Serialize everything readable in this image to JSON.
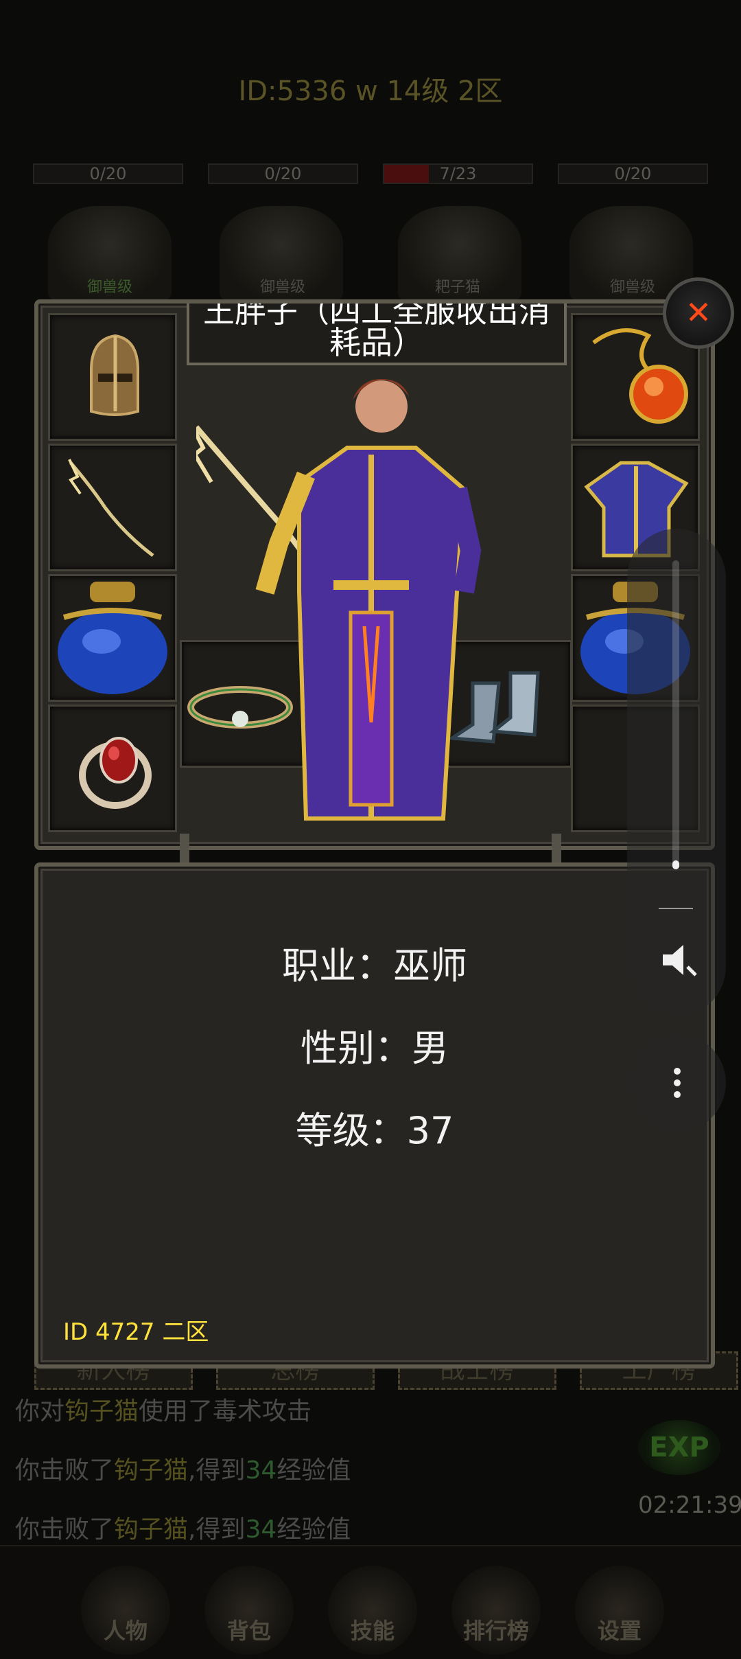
{
  "top_status": "ID:5336  w  14级  2区",
  "hp_bars": [
    {
      "text": "0/20",
      "fill": 0
    },
    {
      "text": "0/20",
      "fill": 0
    },
    {
      "text": "7/23",
      "fill": 0.3
    },
    {
      "text": "0/20",
      "fill": 0
    }
  ],
  "monsters": [
    "御兽级",
    "御兽级",
    "耙子猫",
    "御兽级"
  ],
  "dialog": {
    "title": "王胖子（四工全服收出消耗品）",
    "info": {
      "profession": "职业：巫师",
      "gender": "性别：男",
      "level": "等级：37"
    },
    "player_id": "ID 4727  二区",
    "close_symbol": "✕"
  },
  "equipment_slots": {
    "left": [
      "helmet-icon",
      "necklace-staff-icon",
      "potion-jar-icon",
      "ruby-ring-icon"
    ],
    "right": [
      "amulet-icon",
      "robe-armor-icon",
      "potion-jar-icon",
      "empty"
    ],
    "middle_left": "bracelet-icon",
    "middle_right": "boots-icon"
  },
  "rank_tabs": [
    "新人榜",
    "总榜",
    "战士榜",
    "工厂榜"
  ],
  "battle_log": [
    {
      "parts": [
        {
          "t": "你对",
          "c": ""
        },
        {
          "t": "钩子猫",
          "c": "y"
        },
        {
          "t": "使用了毒术攻击",
          "c": ""
        }
      ]
    },
    {
      "parts": [
        {
          "t": "你击败了",
          "c": ""
        },
        {
          "t": "钩子猫",
          "c": "y"
        },
        {
          "t": ",得到",
          "c": ""
        },
        {
          "t": "34",
          "c": "g"
        },
        {
          "t": "经验值",
          "c": ""
        }
      ]
    },
    {
      "parts": [
        {
          "t": "你击败了",
          "c": ""
        },
        {
          "t": "钩子猫",
          "c": "y"
        },
        {
          "t": ",得到",
          "c": ""
        },
        {
          "t": "34",
          "c": "g"
        },
        {
          "t": "经验值",
          "c": ""
        }
      ]
    }
  ],
  "exp_badge": "EXP",
  "clock": "02:21:39",
  "bottom_nav": [
    "人物",
    "背包",
    "技能",
    "排行榜",
    "设置"
  ],
  "volume_level": 0.03,
  "colors": {
    "accent_yellow": "#ffe23c",
    "close_orange": "#ff4a1a"
  }
}
